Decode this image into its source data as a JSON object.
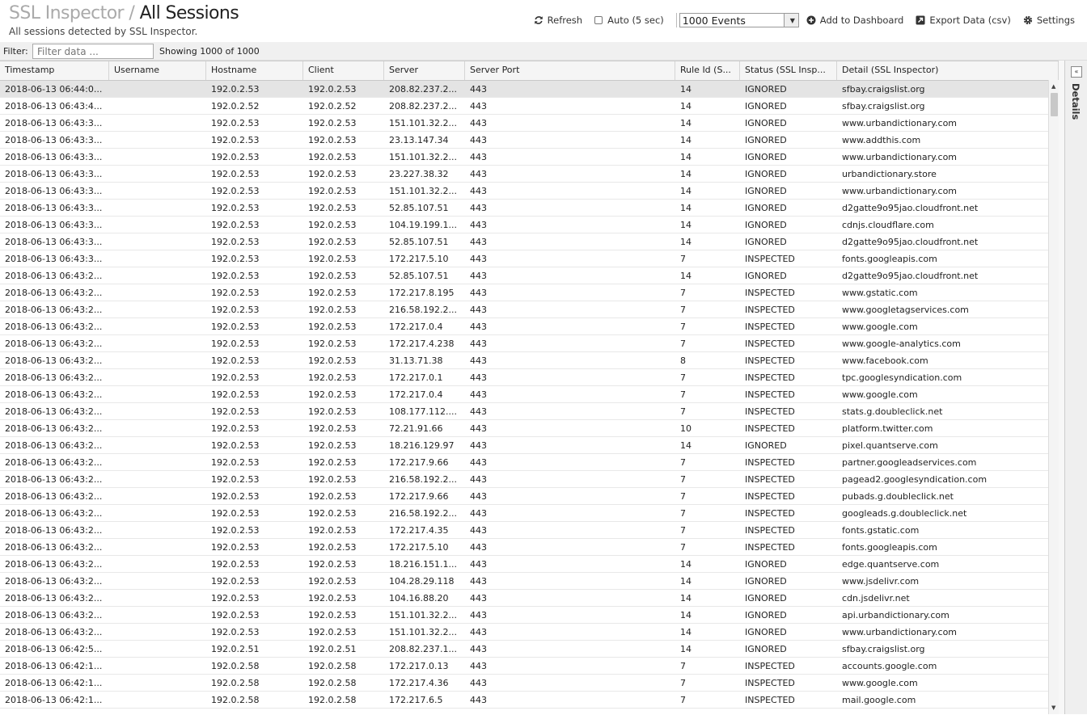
{
  "header": {
    "app_name": "SSL Inspector",
    "separator": " / ",
    "page_title": "All Sessions",
    "subtitle": "All sessions detected by SSL Inspector."
  },
  "toolbar": {
    "refresh_label": "Refresh",
    "auto_label": "Auto (5 sec)",
    "auto_checked": false,
    "events_select_value": "1000 Events",
    "add_dashboard_label": "Add to Dashboard",
    "export_label": "Export Data (csv)",
    "settings_label": "Settings"
  },
  "filter": {
    "label": "Filter:",
    "placeholder": "Filter data ...",
    "showing": "Showing 1000 of 1000"
  },
  "details_panel": {
    "label": "Details"
  },
  "table": {
    "columns": [
      "Timestamp",
      "Username",
      "Hostname",
      "Client",
      "Server",
      "Server Port",
      "Rule Id (S...",
      "Status (SSL Insp...",
      "Detail (SSL Inspector)"
    ],
    "rows": [
      [
        "2018-06-13 06:44:0...",
        "",
        "192.0.2.53",
        "192.0.2.53",
        "208.82.237.2...",
        "443",
        "14",
        "IGNORED",
        "sfbay.craigslist.org"
      ],
      [
        "2018-06-13 06:43:4...",
        "",
        "192.0.2.52",
        "192.0.2.52",
        "208.82.237.2...",
        "443",
        "14",
        "IGNORED",
        "sfbay.craigslist.org"
      ],
      [
        "2018-06-13 06:43:3...",
        "",
        "192.0.2.53",
        "192.0.2.53",
        "151.101.32.2...",
        "443",
        "14",
        "IGNORED",
        "www.urbandictionary.com"
      ],
      [
        "2018-06-13 06:43:3...",
        "",
        "192.0.2.53",
        "192.0.2.53",
        "23.13.147.34",
        "443",
        "14",
        "IGNORED",
        "www.addthis.com"
      ],
      [
        "2018-06-13 06:43:3...",
        "",
        "192.0.2.53",
        "192.0.2.53",
        "151.101.32.2...",
        "443",
        "14",
        "IGNORED",
        "www.urbandictionary.com"
      ],
      [
        "2018-06-13 06:43:3...",
        "",
        "192.0.2.53",
        "192.0.2.53",
        "23.227.38.32",
        "443",
        "14",
        "IGNORED",
        "urbandictionary.store"
      ],
      [
        "2018-06-13 06:43:3...",
        "",
        "192.0.2.53",
        "192.0.2.53",
        "151.101.32.2...",
        "443",
        "14",
        "IGNORED",
        "www.urbandictionary.com"
      ],
      [
        "2018-06-13 06:43:3...",
        "",
        "192.0.2.53",
        "192.0.2.53",
        "52.85.107.51",
        "443",
        "14",
        "IGNORED",
        "d2gatte9o95jao.cloudfront.net"
      ],
      [
        "2018-06-13 06:43:3...",
        "",
        "192.0.2.53",
        "192.0.2.53",
        "104.19.199.1...",
        "443",
        "14",
        "IGNORED",
        "cdnjs.cloudflare.com"
      ],
      [
        "2018-06-13 06:43:3...",
        "",
        "192.0.2.53",
        "192.0.2.53",
        "52.85.107.51",
        "443",
        "14",
        "IGNORED",
        "d2gatte9o95jao.cloudfront.net"
      ],
      [
        "2018-06-13 06:43:3...",
        "",
        "192.0.2.53",
        "192.0.2.53",
        "172.217.5.10",
        "443",
        "7",
        "INSPECTED",
        "fonts.googleapis.com"
      ],
      [
        "2018-06-13 06:43:2...",
        "",
        "192.0.2.53",
        "192.0.2.53",
        "52.85.107.51",
        "443",
        "14",
        "IGNORED",
        "d2gatte9o95jao.cloudfront.net"
      ],
      [
        "2018-06-13 06:43:2...",
        "",
        "192.0.2.53",
        "192.0.2.53",
        "172.217.8.195",
        "443",
        "7",
        "INSPECTED",
        "www.gstatic.com"
      ],
      [
        "2018-06-13 06:43:2...",
        "",
        "192.0.2.53",
        "192.0.2.53",
        "216.58.192.2...",
        "443",
        "7",
        "INSPECTED",
        "www.googletagservices.com"
      ],
      [
        "2018-06-13 06:43:2...",
        "",
        "192.0.2.53",
        "192.0.2.53",
        "172.217.0.4",
        "443",
        "7",
        "INSPECTED",
        "www.google.com"
      ],
      [
        "2018-06-13 06:43:2...",
        "",
        "192.0.2.53",
        "192.0.2.53",
        "172.217.4.238",
        "443",
        "7",
        "INSPECTED",
        "www.google-analytics.com"
      ],
      [
        "2018-06-13 06:43:2...",
        "",
        "192.0.2.53",
        "192.0.2.53",
        "31.13.71.38",
        "443",
        "8",
        "INSPECTED",
        "www.facebook.com"
      ],
      [
        "2018-06-13 06:43:2...",
        "",
        "192.0.2.53",
        "192.0.2.53",
        "172.217.0.1",
        "443",
        "7",
        "INSPECTED",
        "tpc.googlesyndication.com"
      ],
      [
        "2018-06-13 06:43:2...",
        "",
        "192.0.2.53",
        "192.0.2.53",
        "172.217.0.4",
        "443",
        "7",
        "INSPECTED",
        "www.google.com"
      ],
      [
        "2018-06-13 06:43:2...",
        "",
        "192.0.2.53",
        "192.0.2.53",
        "108.177.112....",
        "443",
        "7",
        "INSPECTED",
        "stats.g.doubleclick.net"
      ],
      [
        "2018-06-13 06:43:2...",
        "",
        "192.0.2.53",
        "192.0.2.53",
        "72.21.91.66",
        "443",
        "10",
        "INSPECTED",
        "platform.twitter.com"
      ],
      [
        "2018-06-13 06:43:2...",
        "",
        "192.0.2.53",
        "192.0.2.53",
        "18.216.129.97",
        "443",
        "14",
        "IGNORED",
        "pixel.quantserve.com"
      ],
      [
        "2018-06-13 06:43:2...",
        "",
        "192.0.2.53",
        "192.0.2.53",
        "172.217.9.66",
        "443",
        "7",
        "INSPECTED",
        "partner.googleadservices.com"
      ],
      [
        "2018-06-13 06:43:2...",
        "",
        "192.0.2.53",
        "192.0.2.53",
        "216.58.192.2...",
        "443",
        "7",
        "INSPECTED",
        "pagead2.googlesyndication.com"
      ],
      [
        "2018-06-13 06:43:2...",
        "",
        "192.0.2.53",
        "192.0.2.53",
        "172.217.9.66",
        "443",
        "7",
        "INSPECTED",
        "pubads.g.doubleclick.net"
      ],
      [
        "2018-06-13 06:43:2...",
        "",
        "192.0.2.53",
        "192.0.2.53",
        "216.58.192.2...",
        "443",
        "7",
        "INSPECTED",
        "googleads.g.doubleclick.net"
      ],
      [
        "2018-06-13 06:43:2...",
        "",
        "192.0.2.53",
        "192.0.2.53",
        "172.217.4.35",
        "443",
        "7",
        "INSPECTED",
        "fonts.gstatic.com"
      ],
      [
        "2018-06-13 06:43:2...",
        "",
        "192.0.2.53",
        "192.0.2.53",
        "172.217.5.10",
        "443",
        "7",
        "INSPECTED",
        "fonts.googleapis.com"
      ],
      [
        "2018-06-13 06:43:2...",
        "",
        "192.0.2.53",
        "192.0.2.53",
        "18.216.151.1...",
        "443",
        "14",
        "IGNORED",
        "edge.quantserve.com"
      ],
      [
        "2018-06-13 06:43:2...",
        "",
        "192.0.2.53",
        "192.0.2.53",
        "104.28.29.118",
        "443",
        "14",
        "IGNORED",
        "www.jsdelivr.com"
      ],
      [
        "2018-06-13 06:43:2...",
        "",
        "192.0.2.53",
        "192.0.2.53",
        "104.16.88.20",
        "443",
        "14",
        "IGNORED",
        "cdn.jsdelivr.net"
      ],
      [
        "2018-06-13 06:43:2...",
        "",
        "192.0.2.53",
        "192.0.2.53",
        "151.101.32.2...",
        "443",
        "14",
        "IGNORED",
        "api.urbandictionary.com"
      ],
      [
        "2018-06-13 06:43:2...",
        "",
        "192.0.2.53",
        "192.0.2.53",
        "151.101.32.2...",
        "443",
        "14",
        "IGNORED",
        "www.urbandictionary.com"
      ],
      [
        "2018-06-13 06:42:5...",
        "",
        "192.0.2.51",
        "192.0.2.51",
        "208.82.237.1...",
        "443",
        "14",
        "IGNORED",
        "sfbay.craigslist.org"
      ],
      [
        "2018-06-13 06:42:1...",
        "",
        "192.0.2.58",
        "192.0.2.58",
        "172.217.0.13",
        "443",
        "7",
        "INSPECTED",
        "accounts.google.com"
      ],
      [
        "2018-06-13 06:42:1...",
        "",
        "192.0.2.58",
        "192.0.2.58",
        "172.217.4.36",
        "443",
        "7",
        "INSPECTED",
        "www.google.com"
      ],
      [
        "2018-06-13 06:42:1...",
        "",
        "192.0.2.58",
        "192.0.2.58",
        "172.217.6.5",
        "443",
        "7",
        "INSPECTED",
        "mail.google.com"
      ]
    ]
  }
}
